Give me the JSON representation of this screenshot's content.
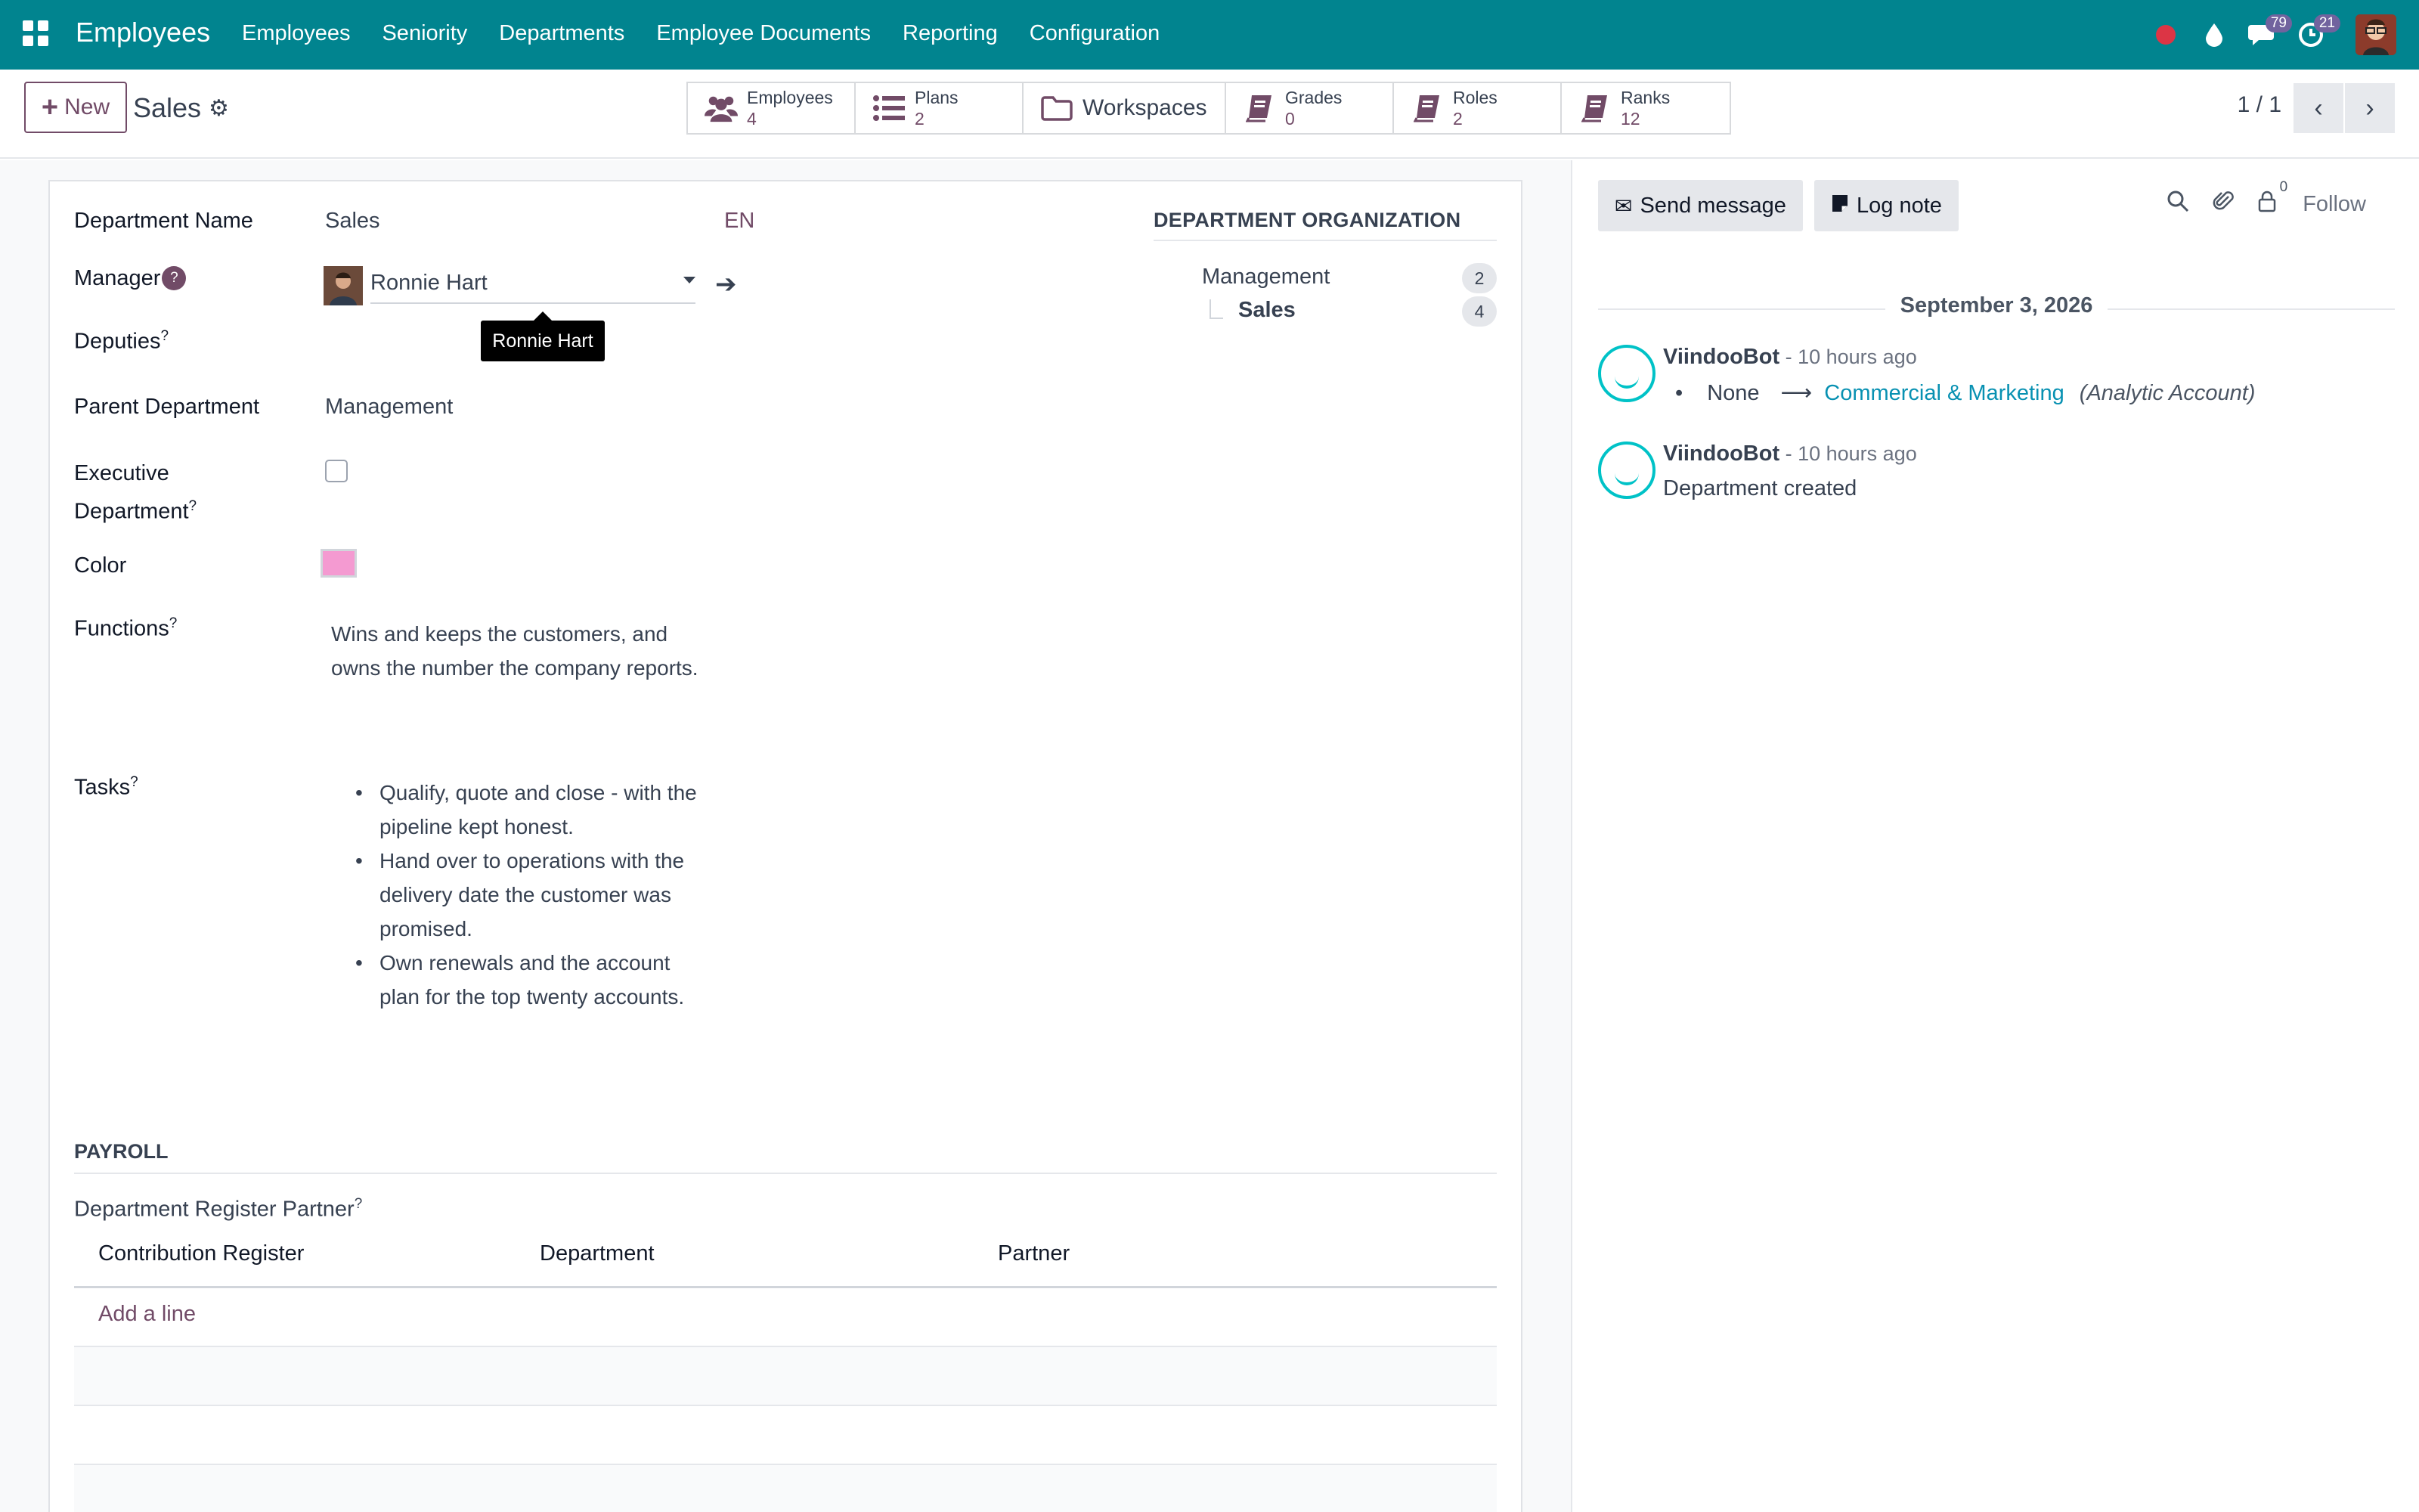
{
  "navbar": {
    "brand": "Employees",
    "menu": [
      "Employees",
      "Seniority",
      "Departments",
      "Employee Documents",
      "Reporting",
      "Configuration"
    ],
    "messages_badge": "79",
    "activities_badge": "21"
  },
  "control": {
    "new_label": "New",
    "title": "Sales",
    "smart_buttons": [
      {
        "label": "Employees",
        "value": "4"
      },
      {
        "label": "Plans",
        "value": "2"
      },
      {
        "label": "Workspaces",
        "value": ""
      },
      {
        "label": "Grades",
        "value": "0"
      },
      {
        "label": "Roles",
        "value": "2"
      },
      {
        "label": "Ranks",
        "value": "12"
      }
    ],
    "pager": "1 / 1"
  },
  "form": {
    "department_name_label": "Department Name",
    "department_name": "Sales",
    "lang": "EN",
    "manager_label": "Manager",
    "manager_help": "?",
    "manager_value": "Ronnie Hart",
    "manager_tooltip": "Ronnie Hart",
    "deputies_label": "Deputies",
    "parent_label": "Parent Department",
    "parent_value": "Management",
    "executive_label_1": "Executive",
    "executive_label_2": "Department",
    "color_label": "Color",
    "color_value": "#f49ad1",
    "functions_label": "Functions",
    "functions_text": "Wins and keeps the customers, and owns the number the company reports.",
    "tasks_label": "Tasks",
    "tasks": [
      "Qualify, quote and close - with the pipeline kept honest.",
      "Hand over to operations with the delivery date the customer was promised.",
      "Own renewals and the account plan for the top twenty accounts."
    ],
    "help_mark": "?"
  },
  "org": {
    "title": "DEPARTMENT ORGANIZATION",
    "rows": [
      {
        "name": "Management",
        "count": "2"
      },
      {
        "name": "Sales",
        "count": "4"
      }
    ]
  },
  "payroll": {
    "title": "PAYROLL",
    "register_label": "Department Register Partner",
    "columns": [
      "Contribution Register",
      "Department",
      "Partner"
    ],
    "add_line": "Add a line"
  },
  "chatter": {
    "send_message": "Send message",
    "log_note": "Log note",
    "followers_count": "0",
    "follow": "Follow",
    "date": "September 3, 2026",
    "messages": [
      {
        "author": "ViindooBot",
        "time": " - 10 hours ago",
        "old": "None",
        "new": "Commercial & Marketing",
        "field": "(Analytic Account)"
      },
      {
        "author": "ViindooBot",
        "time": " - 10 hours ago",
        "body": "Department created"
      }
    ]
  },
  "colors": {
    "navbar": "#01848f",
    "primary": "#714b67",
    "link": "#0891b2"
  }
}
